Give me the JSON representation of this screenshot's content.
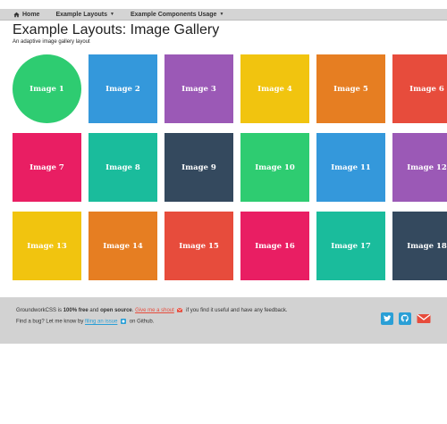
{
  "nav": {
    "home": "Home",
    "layouts": "Example Layouts",
    "components": "Example Components Usage"
  },
  "header": {
    "title": "Example Layouts: Image Gallery",
    "subtitle": "An adaptive image gallery layout"
  },
  "gallery": {
    "tiles": [
      {
        "label": "Image 1",
        "color": "#2ecc71",
        "shape": "circle"
      },
      {
        "label": "Image 2",
        "color": "#3498db",
        "shape": "square"
      },
      {
        "label": "Image 3",
        "color": "#9b59b6",
        "shape": "square"
      },
      {
        "label": "Image 4",
        "color": "#f1c40f",
        "shape": "square"
      },
      {
        "label": "Image 5",
        "color": "#e67e22",
        "shape": "square"
      },
      {
        "label": "Image 6",
        "color": "#e74c3c",
        "shape": "square"
      },
      {
        "label": "Image 7",
        "color": "#e91e63",
        "shape": "square"
      },
      {
        "label": "Image 8",
        "color": "#1abc9c",
        "shape": "square"
      },
      {
        "label": "Image 9",
        "color": "#34495e",
        "shape": "square"
      },
      {
        "label": "Image 10",
        "color": "#2ecc71",
        "shape": "square"
      },
      {
        "label": "Image 11",
        "color": "#3498db",
        "shape": "square"
      },
      {
        "label": "Image 12",
        "color": "#9b59b6",
        "shape": "square"
      },
      {
        "label": "Image 13",
        "color": "#f1c40f",
        "shape": "square"
      },
      {
        "label": "Image 14",
        "color": "#e67e22",
        "shape": "square"
      },
      {
        "label": "Image 15",
        "color": "#e74c3c",
        "shape": "square"
      },
      {
        "label": "Image 16",
        "color": "#e91e63",
        "shape": "square"
      },
      {
        "label": "Image 17",
        "color": "#1abc9c",
        "shape": "square"
      },
      {
        "label": "Image 18",
        "color": "#34495e",
        "shape": "square"
      }
    ]
  },
  "footer": {
    "line1_brand": "GroundworkCSS is ",
    "line1_free": "100% free",
    "line1_and": " and ",
    "line1_open": "open source",
    "line1_dot": ". ",
    "shout_link": "Give me a shout",
    "line1_rest": " if you find it useful and have any feedback.",
    "line2_pre": "Find a bug? Let me know by ",
    "issue_link": "filing an issue",
    "line2_post": " on Github."
  },
  "icons": {
    "home": "home-icon",
    "twitter": "twitter-icon",
    "github": "github-icon",
    "email": "envelope-icon"
  },
  "colors": {
    "twitter": "#2a9fd6",
    "github": "#2a9fd6",
    "email": "#e74c3c",
    "link_shout": "#e74c3c",
    "link_issue": "#2a9fd6"
  }
}
